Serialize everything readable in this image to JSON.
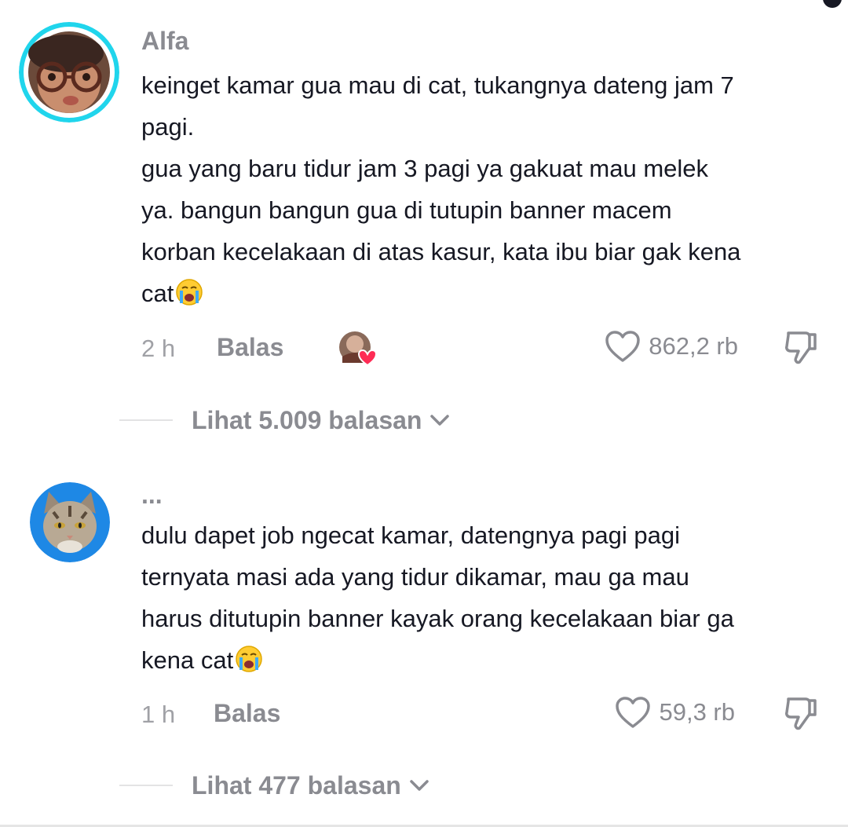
{
  "comments": [
    {
      "username": "Alfa",
      "avatar_icon": "user-avatar-glasses",
      "text_lines": [
        "keinget kamar gua mau di cat, tukangnya dateng jam 7",
        "pagi.",
        "gua yang baru tidur jam 3 pagi ya gakuat mau melek",
        "ya. bangun bangun gua di tutupin banner macem",
        "korban kecelakaan di atas kasur, kata ibu biar gak kena",
        "cat"
      ],
      "emoji": "loudly-crying-face",
      "time": "2 h",
      "reply_label": "Balas",
      "creator_liked": true,
      "likes": "862,2 rb",
      "view_replies": "Lihat 5.009 balasan"
    },
    {
      "username": "...",
      "avatar_icon": "cat-avatar",
      "text_lines": [
        "dulu dapet job ngecat kamar, datengnya pagi pagi",
        "ternyata masi ada yang tidur dikamar, mau ga mau",
        "harus ditutupin banner kayak orang kecelakaan biar ga",
        "kena cat"
      ],
      "emoji": "loudly-crying-face",
      "time": "1 h",
      "reply_label": "Balas",
      "creator_liked": false,
      "likes": "59,3 rb",
      "view_replies": "Lihat 477 balasan"
    }
  ],
  "colors": {
    "text": "#161823",
    "muted": "#8a8b91",
    "avatar_ring": "#20d5ec",
    "heart_red": "#fe2c55",
    "cat_bg": "#1e88e5"
  }
}
